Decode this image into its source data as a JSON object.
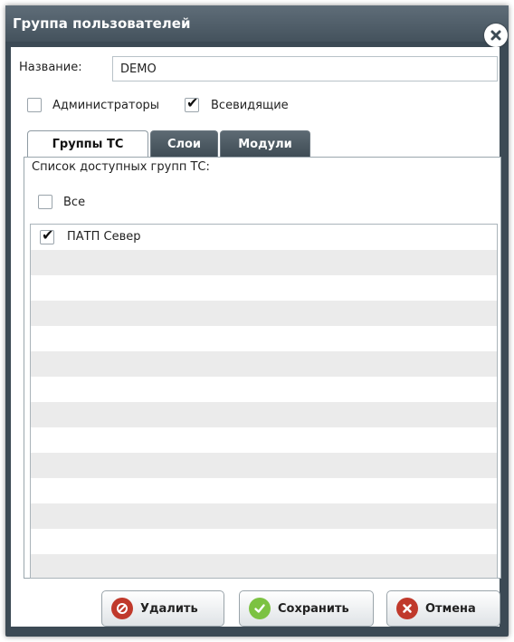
{
  "dialog": {
    "title": "Группа пользователей"
  },
  "form": {
    "name_label": "Название:",
    "name_value": "DEMO",
    "admins_label": "Администраторы",
    "admins_checked": false,
    "seeall_label": "Всевидящие",
    "seeall_checked": true
  },
  "tabs": [
    {
      "label": "Группы ТС",
      "active": true
    },
    {
      "label": "Слои",
      "active": false
    },
    {
      "label": "Модули",
      "active": false
    }
  ],
  "panel": {
    "caption": "Список доступных групп ТС:",
    "all_label": "Все",
    "all_checked": false,
    "items": [
      {
        "label": "ПАТП Север",
        "checked": true
      }
    ]
  },
  "buttons": {
    "delete_label": "Удалить",
    "save_label": "Сохранить",
    "cancel_label": "Отмена"
  },
  "colors": {
    "header": "#44525d",
    "delete": "#c0392b",
    "save": "#7cc242",
    "cancel": "#c0392b"
  },
  "icons": {
    "close": "close-icon",
    "delete": "delete-icon",
    "save": "save-check-icon",
    "cancel": "cancel-x-icon"
  }
}
